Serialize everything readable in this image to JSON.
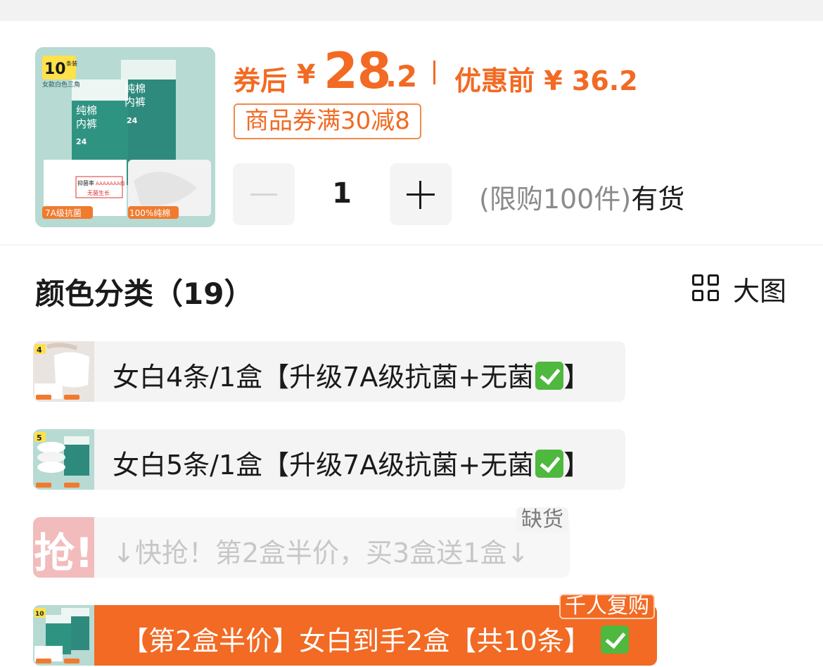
{
  "product": {
    "thumbnail": {
      "pack_count": "10",
      "pack_unit": "条装",
      "subtitle": "女款白色三角",
      "box_title_1": "纯棉",
      "box_title_2": "内裤",
      "box_number": "24",
      "badge_left": "7A级抗菌",
      "badge_right": "100%纯棉",
      "report_line_1": "抑菌率",
      "report_grade": "AAAAAAA级",
      "report_line_2": "无菌生长"
    },
    "price_label": "券后",
    "currency": "¥",
    "price_integer": "28",
    "price_decimal": ".2",
    "original_price_label": "优惠前 ¥ 36.2",
    "coupon": "商品券满30减8",
    "quantity": "1",
    "purchase_limit": "(限购100件)",
    "availability": "有货"
  },
  "section": {
    "title": "颜色分类（19）",
    "big_view_label": "大图"
  },
  "options": [
    {
      "label": "女白4条/1盒【升级7A级抗菌+无菌",
      "suffix": "】",
      "thumb_badge": "4"
    },
    {
      "label": "女白5条/1盒【升级7A级抗菌+无菌",
      "suffix": "】",
      "thumb_badge": "5"
    },
    {
      "label": "↓快抢！第2盒半价，买3盒送1盒↓",
      "thumb_glyph": "抢!",
      "badge": "缺货"
    },
    {
      "label": "【第2盒半价】女白到手2盒【共10条】",
      "thumb_badge": "10",
      "badge": "千人复购"
    }
  ],
  "colors": {
    "accent": "#f26a23",
    "check_green": "#4fb83e",
    "chip_bg": "#f4f4f4"
  }
}
